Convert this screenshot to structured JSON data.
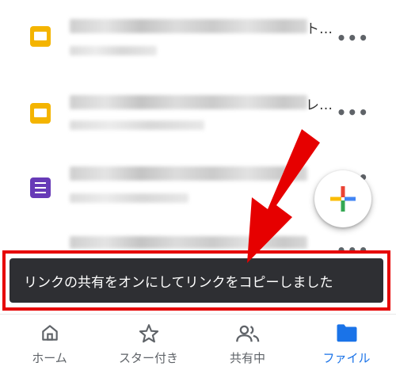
{
  "files": [
    {
      "icon": "slides-icon",
      "trailing_text": "ト…",
      "menu_glyph": "•••"
    },
    {
      "icon": "slides-icon",
      "trailing_text": "レ…",
      "menu_glyph": "•••"
    },
    {
      "icon": "forms-icon",
      "trailing_text": "",
      "menu_glyph": "•••"
    },
    {
      "icon": "unknown-icon",
      "trailing_text": "",
      "menu_glyph": "•••"
    }
  ],
  "snackbar": {
    "message": "リンクの共有をオンにしてリンクをコピーしました"
  },
  "fab": {
    "icon": "plus-icon",
    "colors": [
      "#ea4335",
      "#4285f4",
      "#34a853",
      "#fbbc05"
    ]
  },
  "annotation": {
    "arrow_color": "#e60000",
    "highlight_color": "#e60000"
  },
  "bottom_nav": {
    "items": [
      {
        "label": "ホーム",
        "icon": "home-icon",
        "active": false
      },
      {
        "label": "スター付き",
        "icon": "star-icon",
        "active": false
      },
      {
        "label": "共有中",
        "icon": "people-icon",
        "active": false
      },
      {
        "label": "ファイル",
        "icon": "folder-icon",
        "active": true
      }
    ],
    "active_color": "#1a73e8"
  }
}
